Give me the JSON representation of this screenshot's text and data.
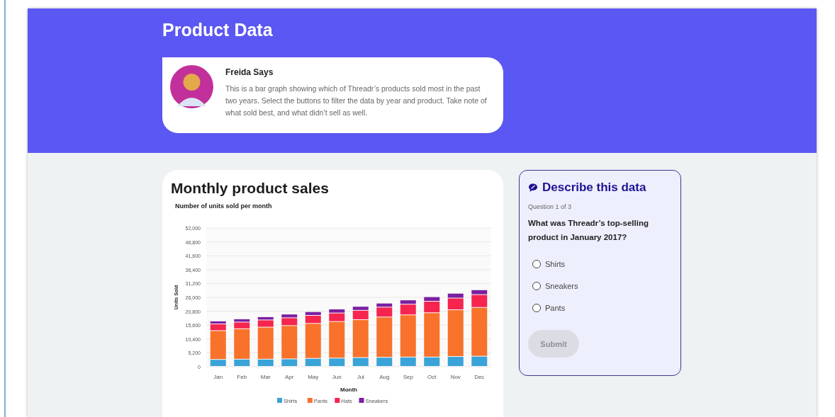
{
  "header": {
    "title": "Product Data"
  },
  "guide": {
    "name": "Freida Says",
    "message": "This is a bar graph showing which of Threadr’s products sold most in the past two years. Select the buttons to filter the data by year and product. Take note of what sold best, and what didn’t sell as well."
  },
  "chart_card": {
    "title": "Monthly product sales",
    "chart_data": {
      "type": "bar",
      "stacked": true,
      "grid": true,
      "legend": true,
      "orientation": "vertical",
      "title": "Number of units sold per month",
      "xlabel": "Month",
      "ylabel": "Units Sold",
      "categories": [
        "Jan",
        "Feb",
        "Mar",
        "Apr",
        "May",
        "Jun",
        "Jul",
        "Aug",
        "Sep",
        "Oct",
        "Nov",
        "Dec"
      ],
      "ylim": [
        0,
        52000
      ],
      "yticks": [
        {
          "value": 0,
          "label": "0"
        },
        {
          "value": 5200,
          "label": "5,200"
        },
        {
          "value": 10400,
          "label": "10,400"
        },
        {
          "value": 15600,
          "label": "15,600"
        },
        {
          "value": 20800,
          "label": "20,800"
        },
        {
          "value": 26000,
          "label": "26,000"
        },
        {
          "value": 31200,
          "label": "31,200"
        },
        {
          "value": 36400,
          "label": "36,400"
        },
        {
          "value": 41600,
          "label": "41,600"
        },
        {
          "value": 46800,
          "label": "46,800"
        },
        {
          "value": 52000,
          "label": "52,000"
        }
      ],
      "series": [
        {
          "name": "Shirts",
          "color": "#3aa3d8",
          "values": [
            2600,
            2700,
            2700,
            2800,
            3000,
            3100,
            3300,
            3400,
            3500,
            3500,
            3700,
            3800
          ]
        },
        {
          "name": "Pants",
          "color": "#f8722b",
          "values": [
            10800,
            11400,
            12000,
            12500,
            13100,
            13700,
            14200,
            15100,
            15800,
            16600,
            17500,
            18300
          ]
        },
        {
          "name": "Hats",
          "color": "#f5254f",
          "values": [
            2500,
            2500,
            2700,
            2900,
            3000,
            3200,
            3500,
            3700,
            4000,
            4300,
            4400,
            4800
          ]
        },
        {
          "name": "Sneakers",
          "color": "#7b1fa2",
          "values": [
            1100,
            1200,
            1200,
            1400,
            1400,
            1500,
            1500,
            1500,
            1600,
            1700,
            1800,
            1800
          ]
        }
      ]
    }
  },
  "quiz": {
    "title": "Describe this data",
    "progress": "Question 1 of 3",
    "question": "What was Threadr’s top-selling product in January 2017?",
    "options": [
      {
        "label": "Shirts",
        "selected": false
      },
      {
        "label": "Sneakers",
        "selected": false
      },
      {
        "label": "Pants",
        "selected": false
      }
    ],
    "submit": {
      "label": "Submit",
      "disabled": true
    }
  }
}
